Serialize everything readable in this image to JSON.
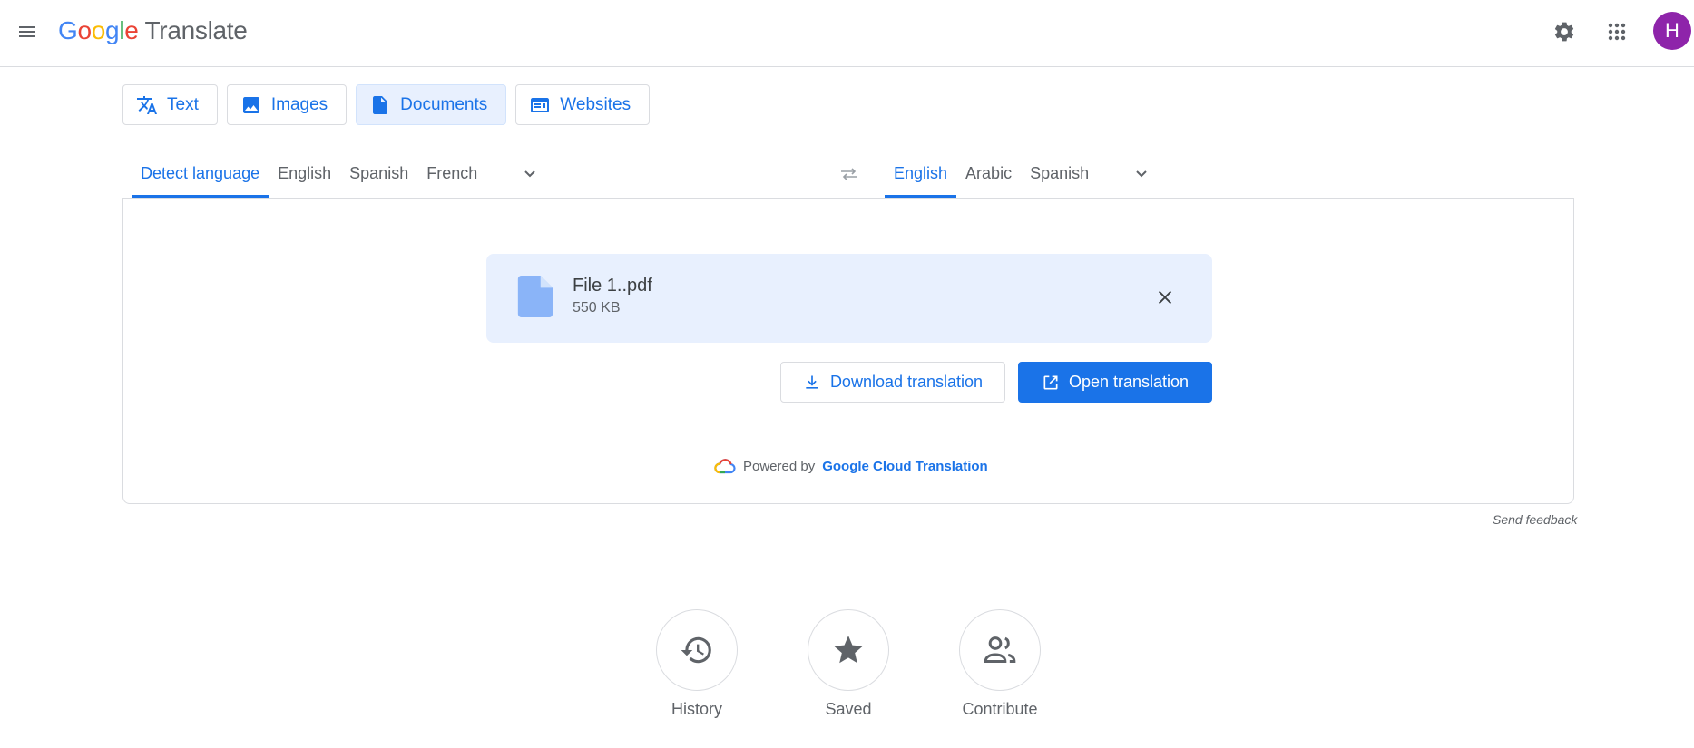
{
  "header": {
    "logo_letters": [
      "G",
      "o",
      "o",
      "g",
      "l",
      "e"
    ],
    "product": "Translate",
    "avatar_initial": "H"
  },
  "mode_tabs": [
    {
      "label": "Text",
      "icon": "translate-icon",
      "active": false
    },
    {
      "label": "Images",
      "icon": "image-icon",
      "active": false
    },
    {
      "label": "Documents",
      "icon": "document-icon",
      "active": true
    },
    {
      "label": "Websites",
      "icon": "website-icon",
      "active": false
    }
  ],
  "source_languages": [
    {
      "label": "Detect language",
      "active": true
    },
    {
      "label": "English",
      "active": false
    },
    {
      "label": "Spanish",
      "active": false
    },
    {
      "label": "French",
      "active": false
    }
  ],
  "target_languages": [
    {
      "label": "English",
      "active": true
    },
    {
      "label": "Arabic",
      "active": false
    },
    {
      "label": "Spanish",
      "active": false
    }
  ],
  "file": {
    "name": "File 1..pdf",
    "size": "550 KB"
  },
  "actions": {
    "download_label": "Download translation",
    "open_label": "Open translation"
  },
  "powered": {
    "prefix": "Powered by",
    "link": "Google Cloud Translation"
  },
  "feedback": "Send feedback",
  "bottom": {
    "history": "History",
    "saved": "Saved",
    "contribute": "Contribute"
  },
  "colors": {
    "accent": "#1a73e8",
    "active_tab_bg": "#e8f0fe",
    "avatar_bg": "#8e24aa"
  }
}
